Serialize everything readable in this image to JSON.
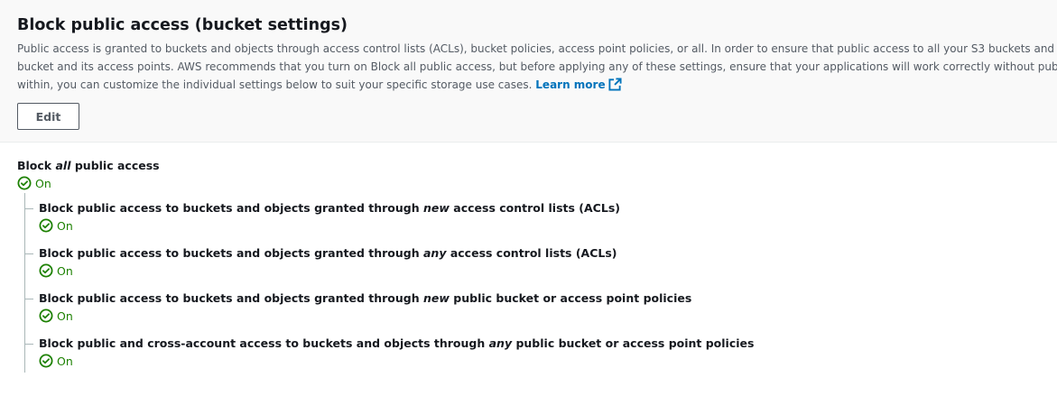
{
  "header": {
    "title": "Block public access (bucket settings)",
    "description_lines": [
      "Public access is granted to buckets and objects through access control lists (ACLs), bucket policies, access point policies, or all. In order to ensure that public access to all your S3 buckets and objects is blocked, turn on Block all public access. These settings apply only to this",
      "bucket and its access points. AWS recommends that you turn on Block all public access, but before applying any of these settings, ensure that your applications will work correctly without public access. If you require some level of public access to your buckets or objects",
      "within, you can customize the individual settings below to suit your specific storage use cases."
    ],
    "learn_more_label": "Learn more",
    "edit_label": "Edit"
  },
  "master_setting": {
    "label_before": "Block ",
    "label_em": "all",
    "label_after": " public access",
    "status": "On"
  },
  "sub_settings": [
    {
      "label_before": "Block public access to buckets and objects granted through ",
      "label_em": "new",
      "label_after": " access control lists (ACLs)",
      "status": "On"
    },
    {
      "label_before": "Block public access to buckets and objects granted through ",
      "label_em": "any",
      "label_after": " access control lists (ACLs)",
      "status": "On"
    },
    {
      "label_before": "Block public access to buckets and objects granted through ",
      "label_em": "new",
      "label_after": " public bucket or access point policies",
      "status": "On"
    },
    {
      "label_before": "Block public and cross-account access to buckets and objects through ",
      "label_em": "any",
      "label_after": " public bucket or access point policies",
      "status": "On"
    }
  ],
  "colors": {
    "status_green": "#1d8102",
    "link_blue": "#0073bb",
    "header_bg": "#f9f9f9"
  },
  "icons": {
    "status": "check-circle-icon",
    "learn_more": "external-link-icon"
  }
}
